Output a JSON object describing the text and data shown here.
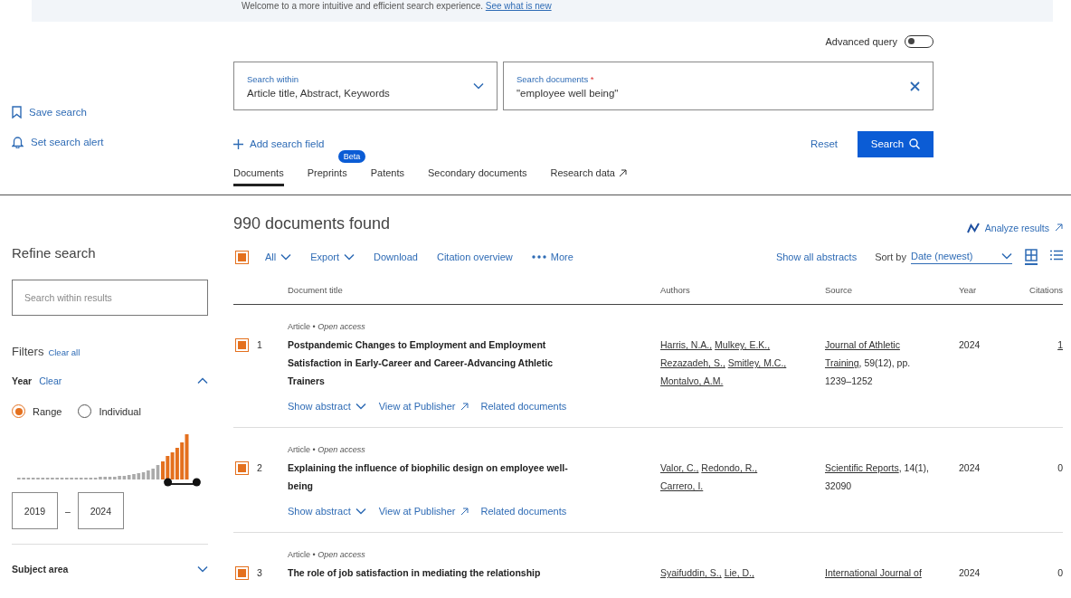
{
  "banner": {
    "text": "Welcome to a more intuitive and efficient search experience.",
    "link": "See what is new"
  },
  "side_actions": [
    {
      "label": "Save search"
    },
    {
      "label": "Set search alert"
    }
  ],
  "advanced_query": {
    "label": "Advanced query",
    "on": false
  },
  "search_within": {
    "label": "Search within",
    "value": "Article title, Abstract, Keywords"
  },
  "search_documents": {
    "label": "Search documents",
    "required_mark": "*",
    "value": "\"employee well being\""
  },
  "add_field": "Add search field",
  "reset": "Reset",
  "search_button": "Search",
  "tabs": [
    {
      "label": "Documents",
      "selected": true
    },
    {
      "label": "Preprints",
      "selected": false,
      "badge": "Beta"
    },
    {
      "label": "Patents",
      "selected": false
    },
    {
      "label": "Secondary documents",
      "selected": false
    },
    {
      "label": "Research data",
      "selected": false,
      "external": true
    }
  ],
  "results_count": "990 documents found",
  "analyze": "Analyze results",
  "refine": {
    "title": "Refine search",
    "placeholder": "Search within results"
  },
  "filters": {
    "title": "Filters",
    "clear_all": "Clear all"
  },
  "year_filter": {
    "title": "Year",
    "clear": "Clear",
    "expanded": true,
    "modes": [
      {
        "label": "Range",
        "selected": true
      },
      {
        "label": "Individual",
        "selected": false
      }
    ],
    "handles": [
      {
        "level": 0.8
      },
      {
        "level": 0.95
      }
    ],
    "from": "2019",
    "separator": "–",
    "to": "2024"
  },
  "subject_area": {
    "title": "Subject area",
    "expanded": false
  },
  "toolbar": {
    "select_all": {
      "label": "All",
      "checked": true
    },
    "actions": [
      {
        "label": "Export",
        "kind": "menu"
      },
      {
        "label": "Download",
        "kind": "link"
      },
      {
        "label": "Citation overview",
        "kind": "link"
      },
      {
        "label": "More",
        "kind": "more"
      }
    ],
    "show_all_abstracts": "Show all abstracts",
    "sort_label": "Sort by",
    "sort_value": "Date (newest)",
    "views": [
      {
        "kind": "table",
        "selected": true
      },
      {
        "kind": "list",
        "selected": false
      }
    ]
  },
  "table": {
    "columns": [
      "Document title",
      "Authors",
      "Source",
      "Year",
      "Citations"
    ],
    "rows": [
      {
        "checked": true,
        "number": "1",
        "meta": "Article • *Open access*",
        "title": "Postpandemic Changes to Employment and Employment Satisfaction in Early-Career and Career-Advancing Athletic Trainers",
        "links": [
          {
            "label": "Show abstract",
            "kind": "menu"
          },
          {
            "label": "View at Publisher",
            "kind": "external"
          },
          {
            "label": "Related documents",
            "kind": "plain"
          }
        ],
        "authors": [
          "Harris, N.A.,",
          "Mulkey, E.K.,",
          "Rezazadeh, S.,",
          "Smitley, M.C.,",
          "Montalvo, A.M."
        ],
        "source_link": "Journal of Athletic Training",
        "source_rest": ", 59(12), pp. 1239–1252",
        "year": "2024",
        "citations": "1",
        "citations_link": true
      },
      {
        "checked": true,
        "number": "2",
        "meta": "Article • *Open access*",
        "title": "Explaining the influence of biophilic design on employee well-being",
        "links": [
          {
            "label": "Show abstract",
            "kind": "menu"
          },
          {
            "label": "View at Publisher",
            "kind": "external"
          },
          {
            "label": "Related documents",
            "kind": "plain"
          }
        ],
        "authors": [
          "Valor, C.,",
          "Redondo, R.,",
          "Carrero, I."
        ],
        "source_link": "Scientific Reports",
        "source_rest": ", 14(1), 32090",
        "year": "2024",
        "citations": "0",
        "citations_link": false
      },
      {
        "checked": true,
        "number": "3",
        "meta": "Article • *Open access*",
        "title": "The role of job satisfaction in mediating the relationship",
        "authors": [
          "Syaifuddin, S.,",
          "Lie, D.,"
        ],
        "source_link": "International Journal of",
        "year": "2024",
        "citations": "0",
        "citations_link": false
      }
    ]
  }
}
